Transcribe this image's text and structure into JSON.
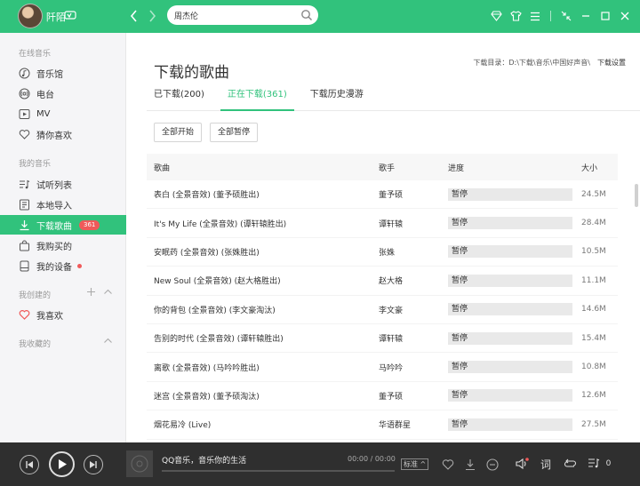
{
  "user": {
    "name": "阡陌"
  },
  "search": {
    "value": "周杰伦"
  },
  "sidebar": {
    "online_music": "在线音乐",
    "online_items": [
      "音乐馆",
      "电台",
      "MV",
      "猜你喜欢"
    ],
    "my_music": "我的音乐",
    "my_items": [
      "试听列表",
      "本地导入",
      "下载歌曲",
      "我购买的",
      "我的设备"
    ],
    "download_badge": "361",
    "created": "我创建的",
    "created_items": [
      "我喜欢"
    ],
    "collected": "我收藏的"
  },
  "main": {
    "title": "下载的歌曲",
    "dir_label": "下载目录：D:\\下载\\音乐\\中国好声音\\",
    "dir_settings": "下载设置",
    "tabs": [
      "已下载(200)",
      "正在下载(361)",
      "下载历史漫游"
    ],
    "start_all": "全部开始",
    "pause_all": "全部暂停",
    "columns": {
      "song": "歌曲",
      "singer": "歌手",
      "progress": "进度",
      "size": "大小"
    },
    "rows": [
      {
        "song": "表白 (全景音效) (董予硕胜出)",
        "singer": "董予硕",
        "status": "暂停",
        "size": "24.5M"
      },
      {
        "song": "It's My Life (全景音效) (谭轩辕胜出)",
        "singer": "谭轩辕",
        "status": "暂停",
        "size": "28.4M"
      },
      {
        "song": "安眠药 (全景音效) (张姝胜出)",
        "singer": "张姝",
        "status": "暂停",
        "size": "10.5M"
      },
      {
        "song": "New Soul (全景音效) (赵大格胜出)",
        "singer": "赵大格",
        "status": "暂停",
        "size": "11.1M"
      },
      {
        "song": "你的背包 (全景音效) (李文豪淘汰)",
        "singer": "李文豪",
        "status": "暂停",
        "size": "14.6M"
      },
      {
        "song": "告别的时代 (全景音效) (谭轩辕胜出)",
        "singer": "谭轩辕",
        "status": "暂停",
        "size": "15.4M"
      },
      {
        "song": "离歌 (全景音效) (马吟吟胜出)",
        "singer": "马吟吟",
        "status": "暂停",
        "size": "10.8M"
      },
      {
        "song": "迷宫 (全景音效) (董予硕淘汰)",
        "singer": "董予硕",
        "status": "暂停",
        "size": "12.6M"
      },
      {
        "song": "烟花易冷 (Live)",
        "singer": "华语群星",
        "status": "暂停",
        "size": "27.5M"
      }
    ]
  },
  "player": {
    "title": "QQ音乐，音乐你的生活",
    "time": "00:00 / 00:00",
    "quality": "标准",
    "playlist_count": "0"
  },
  "colors": {
    "accent": "#31c27c",
    "badge": "#f05a5a",
    "player_bg": "#2f2f2f"
  }
}
